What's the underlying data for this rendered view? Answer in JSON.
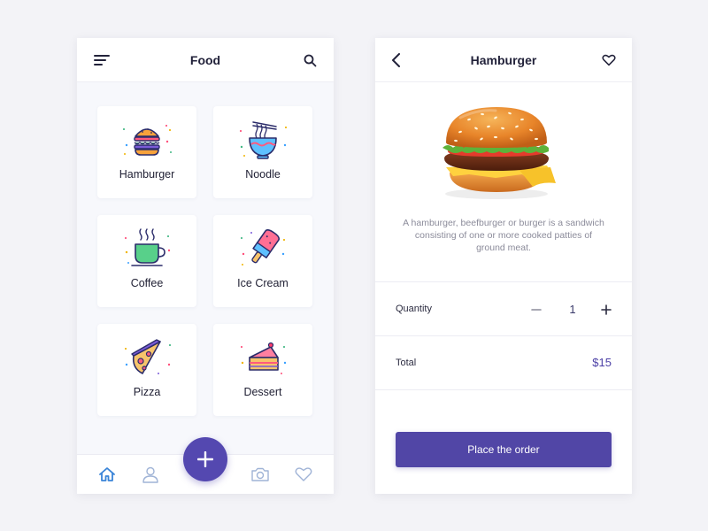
{
  "left_screen": {
    "header": {
      "title": "Food",
      "menu_icon": "menu-icon",
      "search_icon": "search-icon"
    },
    "categories": [
      {
        "label": "Hamburger",
        "icon": "hamburger-icon"
      },
      {
        "label": "Noodle",
        "icon": "noodle-bowl-icon"
      },
      {
        "label": "Coffee",
        "icon": "coffee-cup-icon"
      },
      {
        "label": "Ice Cream",
        "icon": "ice-cream-icon"
      },
      {
        "label": "Pizza",
        "icon": "pizza-slice-icon"
      },
      {
        "label": "Dessert",
        "icon": "cake-slice-icon"
      }
    ],
    "bottom_nav": {
      "items": [
        "home-icon",
        "profile-icon",
        "camera-icon",
        "heart-icon"
      ],
      "active": "home-icon",
      "fab_icon": "plus-icon"
    }
  },
  "right_screen": {
    "header": {
      "title": "Hamburger",
      "back_icon": "back-arrow-icon",
      "favorite_icon": "heart-icon"
    },
    "image": "hamburger-photo",
    "description": "A hamburger, beefburger or burger is a sandwich consisting of one or more cooked patties of ground meat.",
    "quantity": {
      "label": "Quantity",
      "value": "1",
      "decrease_icon": "minus-icon",
      "increase_icon": "plus-icon"
    },
    "total": {
      "label": "Total",
      "value": "$15"
    },
    "order_button": {
      "label": "Place the order"
    }
  },
  "colors": {
    "accent": "#5448b0",
    "nav_active": "#3a84d8",
    "text_dark": "#22223a",
    "text_muted": "#8b8b9a"
  }
}
